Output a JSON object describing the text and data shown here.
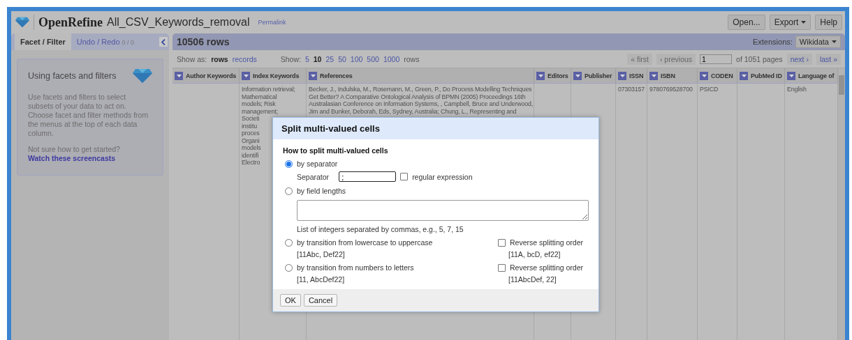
{
  "header": {
    "app_name": "OpenRefine",
    "project_name": "All_CSV_Keywords_removal",
    "permalink": "Permalink",
    "buttons": [
      {
        "label": "Open...",
        "caret": false
      },
      {
        "label": "Export",
        "caret": true
      },
      {
        "label": "Help",
        "caret": false
      }
    ]
  },
  "left_panel": {
    "tabs": [
      {
        "label": "Facet / Filter",
        "selected": true
      },
      {
        "label": "Undo / Redo",
        "count": "0 / 0",
        "selected": false
      }
    ],
    "help_card": {
      "title": "Using facets and filters",
      "body": "Use facets and filters to select subsets of your data to act on. Choose facet and filter methods from the menus at the top of each data column.",
      "question": "Not sure how to get started?",
      "link": "Watch these screencasts"
    }
  },
  "data_panel": {
    "row_count": "10506 rows",
    "extensions_label": "Extensions:",
    "extensions_button": "Wikidata",
    "show_as": {
      "label": "Show as:",
      "options": [
        {
          "label": "rows",
          "selected": true
        },
        {
          "label": "records",
          "selected": false
        }
      ]
    },
    "show": {
      "label": "Show:",
      "suffix": "rows",
      "options": [
        {
          "label": "5",
          "selected": false
        },
        {
          "label": "10",
          "selected": true
        },
        {
          "label": "25",
          "selected": false
        },
        {
          "label": "50",
          "selected": false
        },
        {
          "label": "100",
          "selected": false
        },
        {
          "label": "500",
          "selected": false
        },
        {
          "label": "1000",
          "selected": false
        }
      ]
    },
    "pagination": {
      "first": {
        "label": "« first",
        "disabled": true
      },
      "previous": {
        "label": "‹ previous",
        "disabled": true
      },
      "page": "1",
      "of_pages": "of 1051 pages",
      "next": {
        "label": "next ›",
        "disabled": false
      },
      "last": {
        "label": "last »",
        "disabled": false
      }
    },
    "columns": [
      "Author Keywords",
      "Index Keywords",
      "References",
      "Editors",
      "Publisher",
      "ISSN",
      "ISBN",
      "CODEN",
      "PubMed ID",
      "Language of"
    ],
    "rows": [
      {
        "cells": [
          [],
          [
            "Information retrieval;",
            "Mathematical",
            "models; Risk",
            "management;",
            "Societi",
            "institu",
            "proces",
            "Organi",
            "models",
            "identifi",
            "Electro"
          ],
          [
            "Becker, J., Indulska, M., Rosemann, M., Green, P., Do Process Modelling Techniques",
            "Get Better? A Comparative Ontological Analysis of BPMN (2005) Proceedings 16th",
            "Australasian Conference on Information Systems, , Campbell, Bruce and Underwood,",
            "Jim and Bunker, Deborah, Eds, Sydney, Australia; Chung, L., Representing and"
          ],
          [],
          [],
          [
            "07303157"
          ],
          [
            "9780769528700"
          ],
          [
            "PSICD"
          ],
          [],
          [
            "English"
          ]
        ]
      }
    ]
  },
  "dialog": {
    "title": "Split multi-valued cells",
    "heading": "How to split multi-valued cells",
    "options": [
      {
        "kind": "separator",
        "label": "by separator",
        "selected": true,
        "field_label": "Separator",
        "value": ";",
        "regex_label": "regular expression",
        "regex_checked": false
      },
      {
        "kind": "field_lengths",
        "label": "by field lengths",
        "selected": false,
        "hint": "List of integers separated by commas, e.g., 5, 7, 15"
      },
      {
        "kind": "transition",
        "label": "by transition from lowercase to uppercase",
        "example": "[11Abc, Def22]",
        "selected": false,
        "reverse_label": "Reverse splitting order",
        "reverse_example": "[11A, bcD, ef22]",
        "reverse_checked": false
      },
      {
        "kind": "transition",
        "label": "by transition from numbers to letters",
        "example": "[11, AbcDef22]",
        "selected": false,
        "reverse_label": "Reverse splitting order",
        "reverse_example": "[11AbcDef, 22]",
        "reverse_checked": false
      }
    ],
    "buttons": [
      "OK",
      "Cancel"
    ]
  }
}
